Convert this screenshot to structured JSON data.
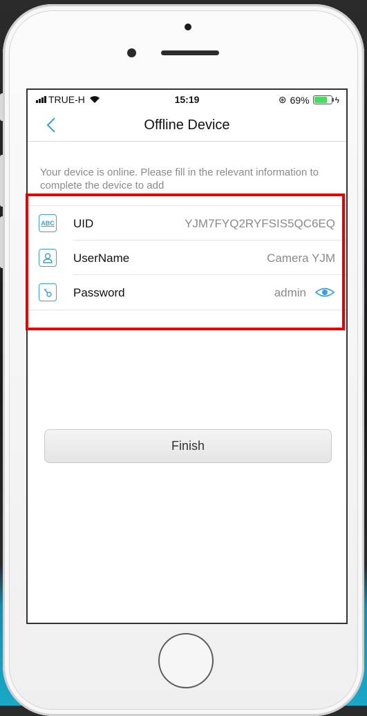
{
  "status_bar": {
    "carrier": "TRUE-H",
    "time": "15:19",
    "lock_glyph": "⊛",
    "battery_percent": "69%",
    "battery_level": 0.69,
    "wifi_glyph": "◔"
  },
  "nav": {
    "title": "Offline Device",
    "back_icon": "chevron-left-icon"
  },
  "info_text": "Your device is online. Please fill in the relevant information to complete the device to add",
  "form": {
    "rows": [
      {
        "label": "UID",
        "value": "YJM7FYQ2RYFSIS5QC6EQ",
        "icon": "abc-icon",
        "icon_text": "ABC"
      },
      {
        "label": "UserName",
        "value": "Camera YJM",
        "icon": "user-icon"
      },
      {
        "label": "Password",
        "value": "admin",
        "icon": "key-icon"
      }
    ]
  },
  "finish_button": "Finish",
  "colors": {
    "accent": "#3b9fd6",
    "highlight": "#e80000",
    "battery": "#4cd964"
  }
}
